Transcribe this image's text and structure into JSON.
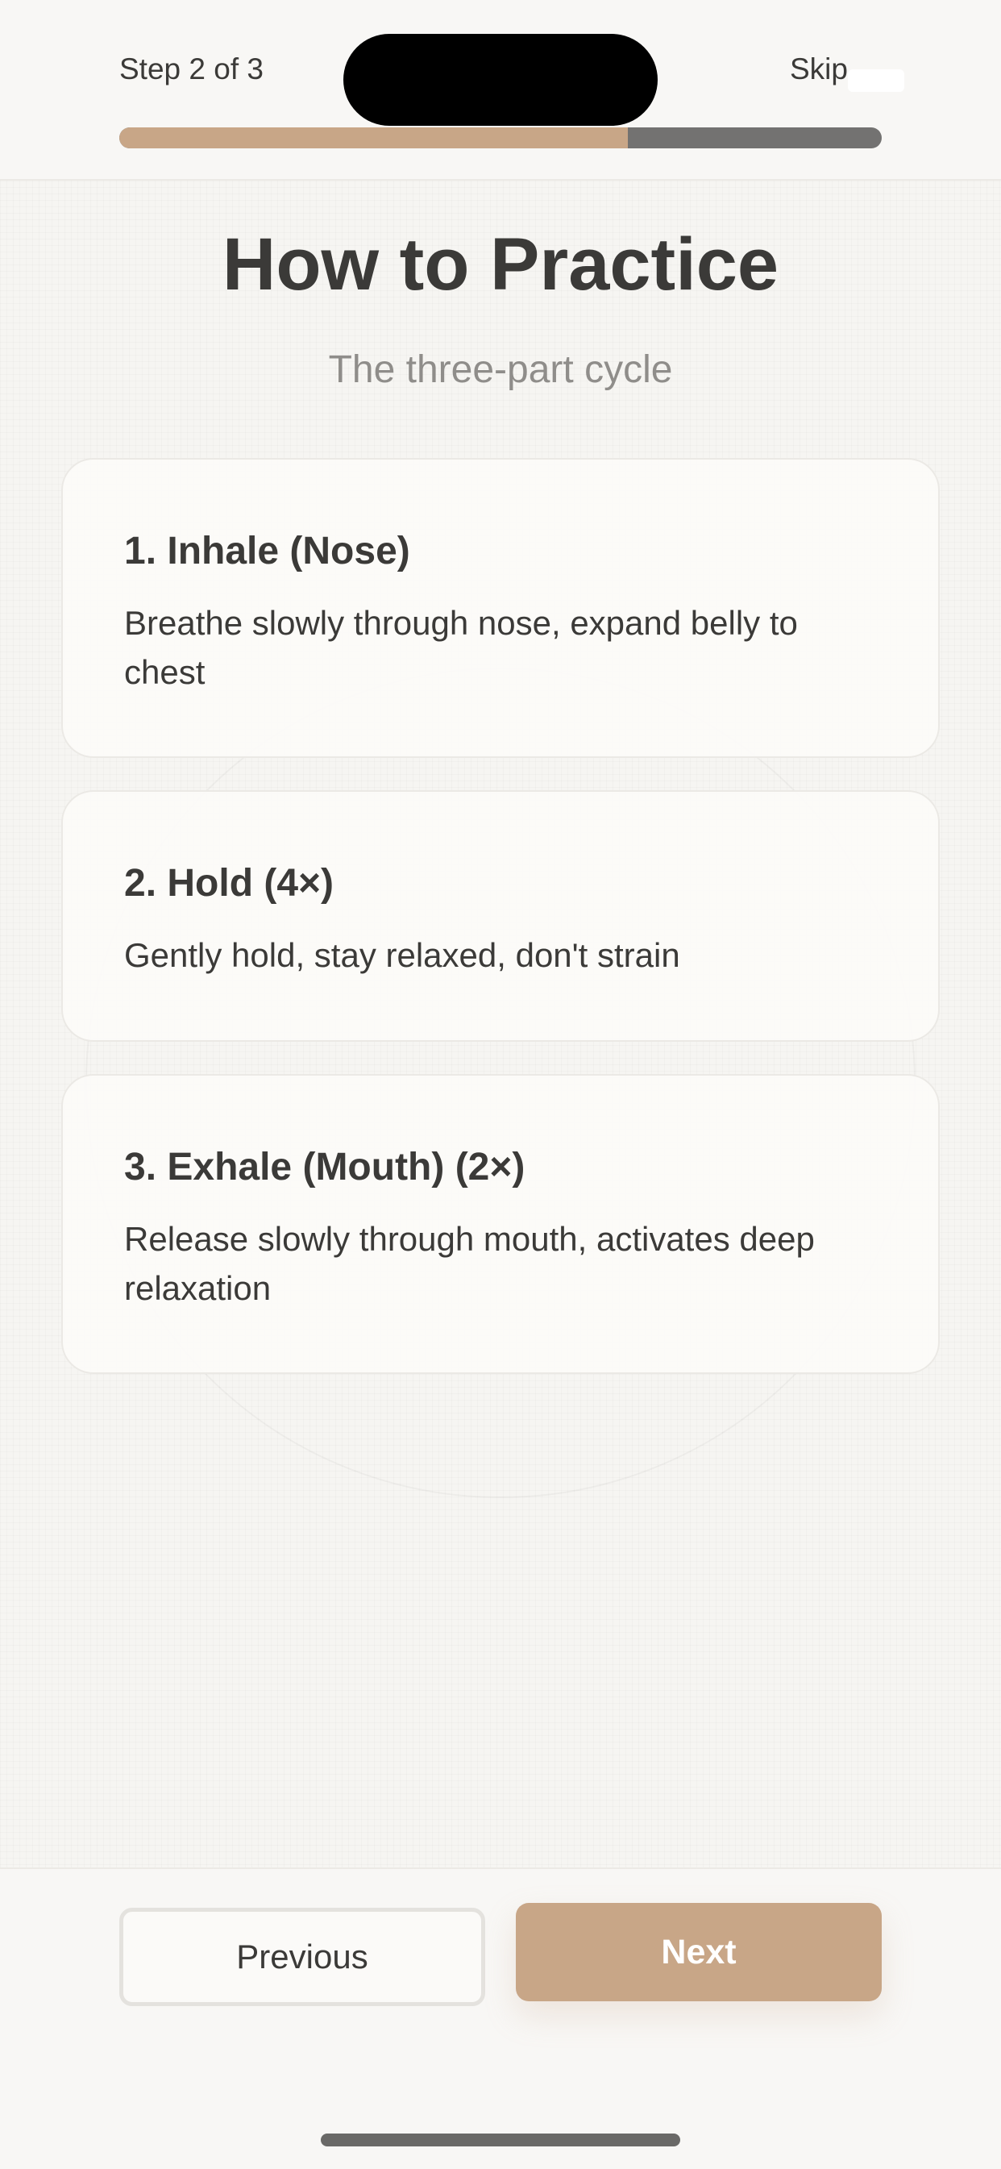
{
  "header": {
    "step_label": "Step 2 of 3",
    "skip_label": "Skip",
    "progress_fraction": 0.667,
    "progress_color": "#c8a687",
    "track_color": "#737271"
  },
  "main": {
    "title": "How to Practice",
    "subtitle": "The three-part cycle",
    "cards": [
      {
        "title": "1. Inhale (Nose)",
        "description": "Breathe slowly through nose, expand belly to chest"
      },
      {
        "title": "2. Hold (4×)",
        "description": "Gently hold, stay relaxed, don't strain"
      },
      {
        "title": "3. Exhale (Mouth) (2×)",
        "description": "Release slowly through mouth, activates deep relaxation"
      }
    ]
  },
  "footer": {
    "previous_label": "Previous",
    "next_label": "Next",
    "accent_color": "#c8a687"
  }
}
